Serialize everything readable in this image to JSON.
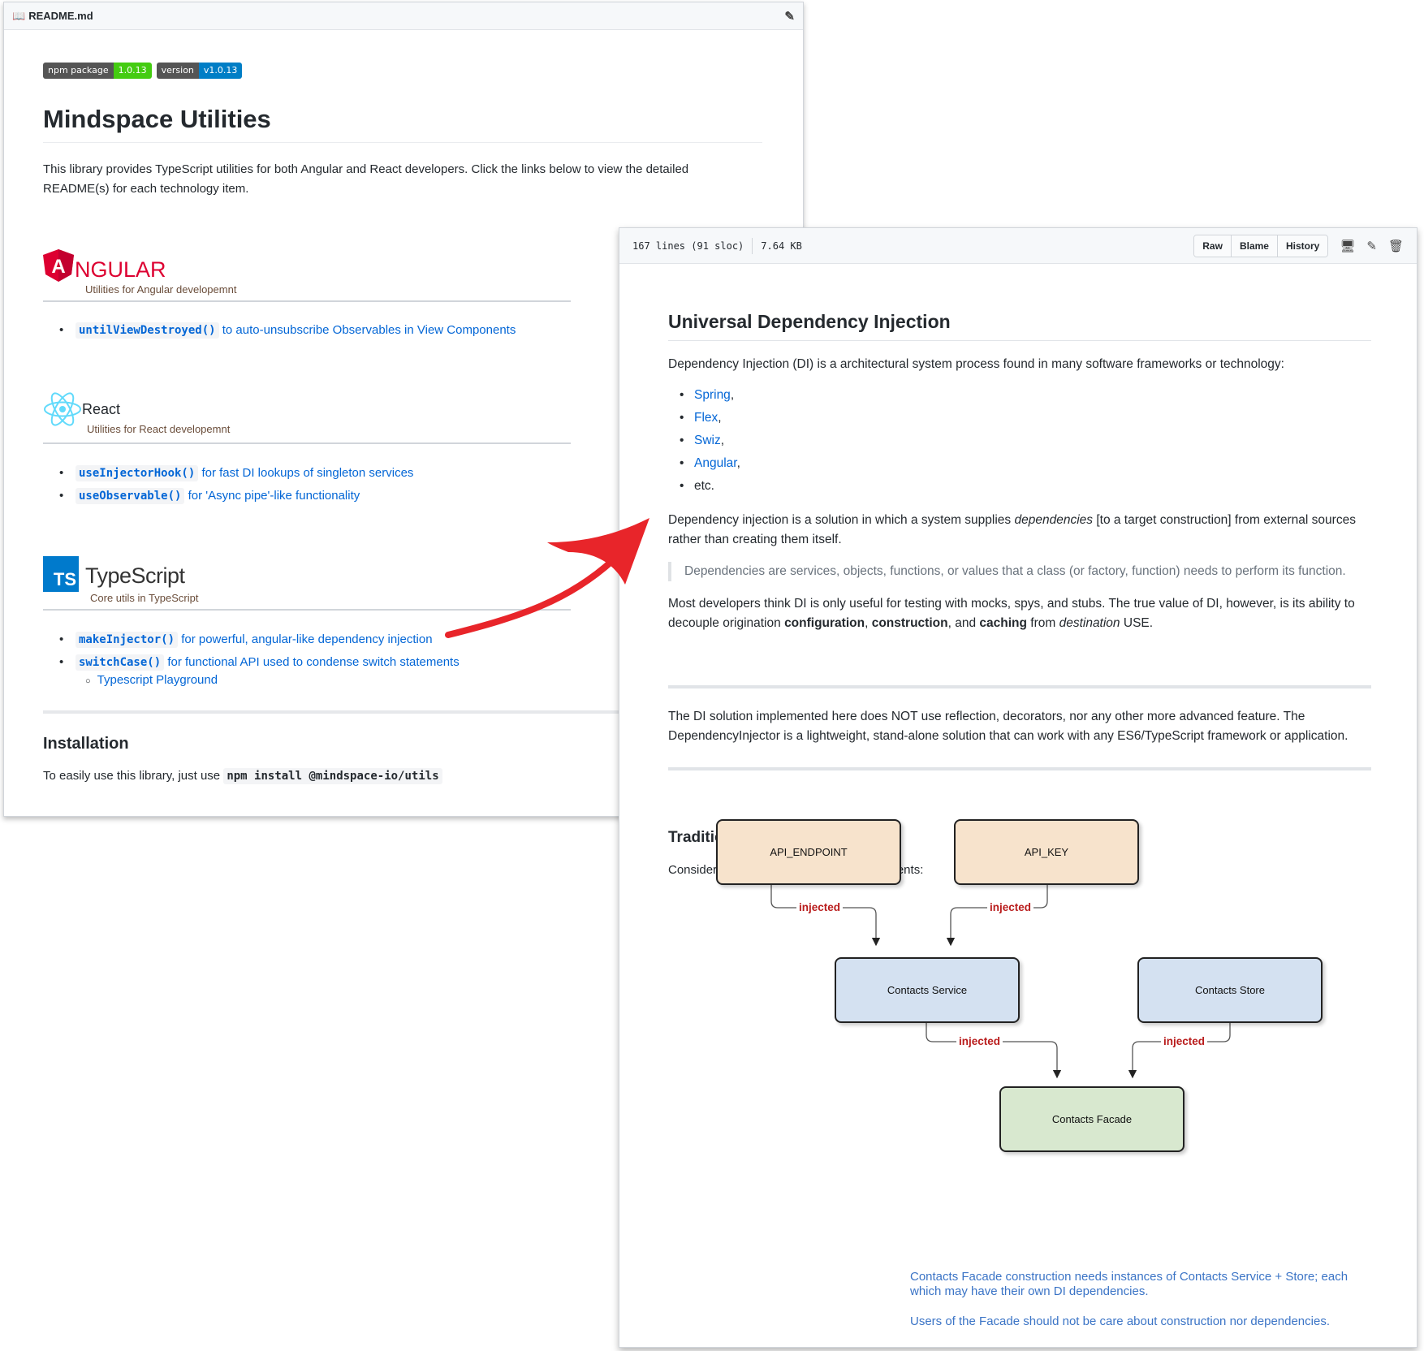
{
  "readme": {
    "filename": "README.md",
    "badges": [
      {
        "label": "npm package",
        "value": "1.0.13",
        "color": "#44cc11"
      },
      {
        "label": "version",
        "value": "v1.0.13",
        "color": "#007ec6"
      }
    ],
    "title": "Mindspace Utilities",
    "intro": "This library provides TypeScript utilities for both Angular and React developers. Click the links below to view the detailed README(s) for each technology item.",
    "angular": {
      "logo_letter": "A",
      "logo_text": "NGULAR",
      "subtitle": "Utilities for Angular developemnt",
      "items": [
        {
          "code": "untilViewDestroyed()",
          "text": "to auto-unsubscribe Observables in View Components"
        }
      ]
    },
    "react": {
      "name": "React",
      "subtitle": "Utilities for React developemnt",
      "items": [
        {
          "code": "useInjectorHook()",
          "text": "for fast DI lookups of singleton services"
        },
        {
          "code": "useObservable()",
          "text": "for 'Async pipe'-like functionality"
        }
      ]
    },
    "typescript": {
      "logo_abbr": "TS",
      "name": "TypeScript",
      "subtitle": "Core utils in TypeScript",
      "items": [
        {
          "code": "makeInjector()",
          "text": "for powerful, angular-like dependency injection"
        },
        {
          "code": "switchCase()",
          "text": "for functional API used to condense switch statements"
        }
      ],
      "subitem": "Typescript Playground"
    },
    "installation": {
      "title": "Installation",
      "text": "To easily use this library, just use",
      "command": "npm install @mindspace-io/utils"
    }
  },
  "file_view": {
    "lines": "167 lines (91 sloc)",
    "size": "7.64 KB",
    "buttons": [
      "Raw",
      "Blame",
      "History"
    ],
    "title": "Universal Dependency Injection",
    "intro": "Dependency Injection (DI) is a architectural system process found in many software frameworks or technology:",
    "frameworks": [
      "Spring",
      "Flex",
      "Swiz",
      "Angular"
    ],
    "etc": "etc.",
    "para1_a": "Dependency injection is a solution in which a system supplies",
    "para1_em": "dependencies",
    "para1_b": "[to a target construction] from external sources rather than creating them itself.",
    "quote": "Dependencies are services, objects, functions, or values that a class (or factory, function) needs to perform its function.",
    "para2_a": "Most developers think DI is only useful for testing with mocks, spys, and stubs. The true value of DI, however, is its ability to decouple origination",
    "para2_b1": "configuration",
    "para2_b2": "construction",
    "para2_b3": "caching",
    "para2_em": "destination",
    "para2_end": "USE.",
    "para3": "The DI solution implemented here does NOT use reflection, decorators, nor any other more advanced feature. The DependencyInjector is a lightweight, stand-alone solution that can work with any ES6/TypeScript framework or application.",
    "section_title": "Traditional Scenario",
    "section_intro": "Consider the following coupling of components:",
    "diagram": {
      "boxes": [
        "API_ENDPOINT",
        "API_KEY",
        "Contacts Service",
        "Contacts Store",
        "Contacts Facade"
      ],
      "edge_label": "injected",
      "note1": "Contacts Facade construction needs instances of Contacts Service + Store; each which may have their own DI dependencies.",
      "note2": "Users of the Facade should not be care about construction nor dependencies."
    }
  },
  "colors": {
    "link": "#0366d6",
    "angular_red": "#dd0031",
    "ts_blue": "#007acc",
    "arrow_red": "#e8252a",
    "injected_red": "#b91c1c"
  }
}
